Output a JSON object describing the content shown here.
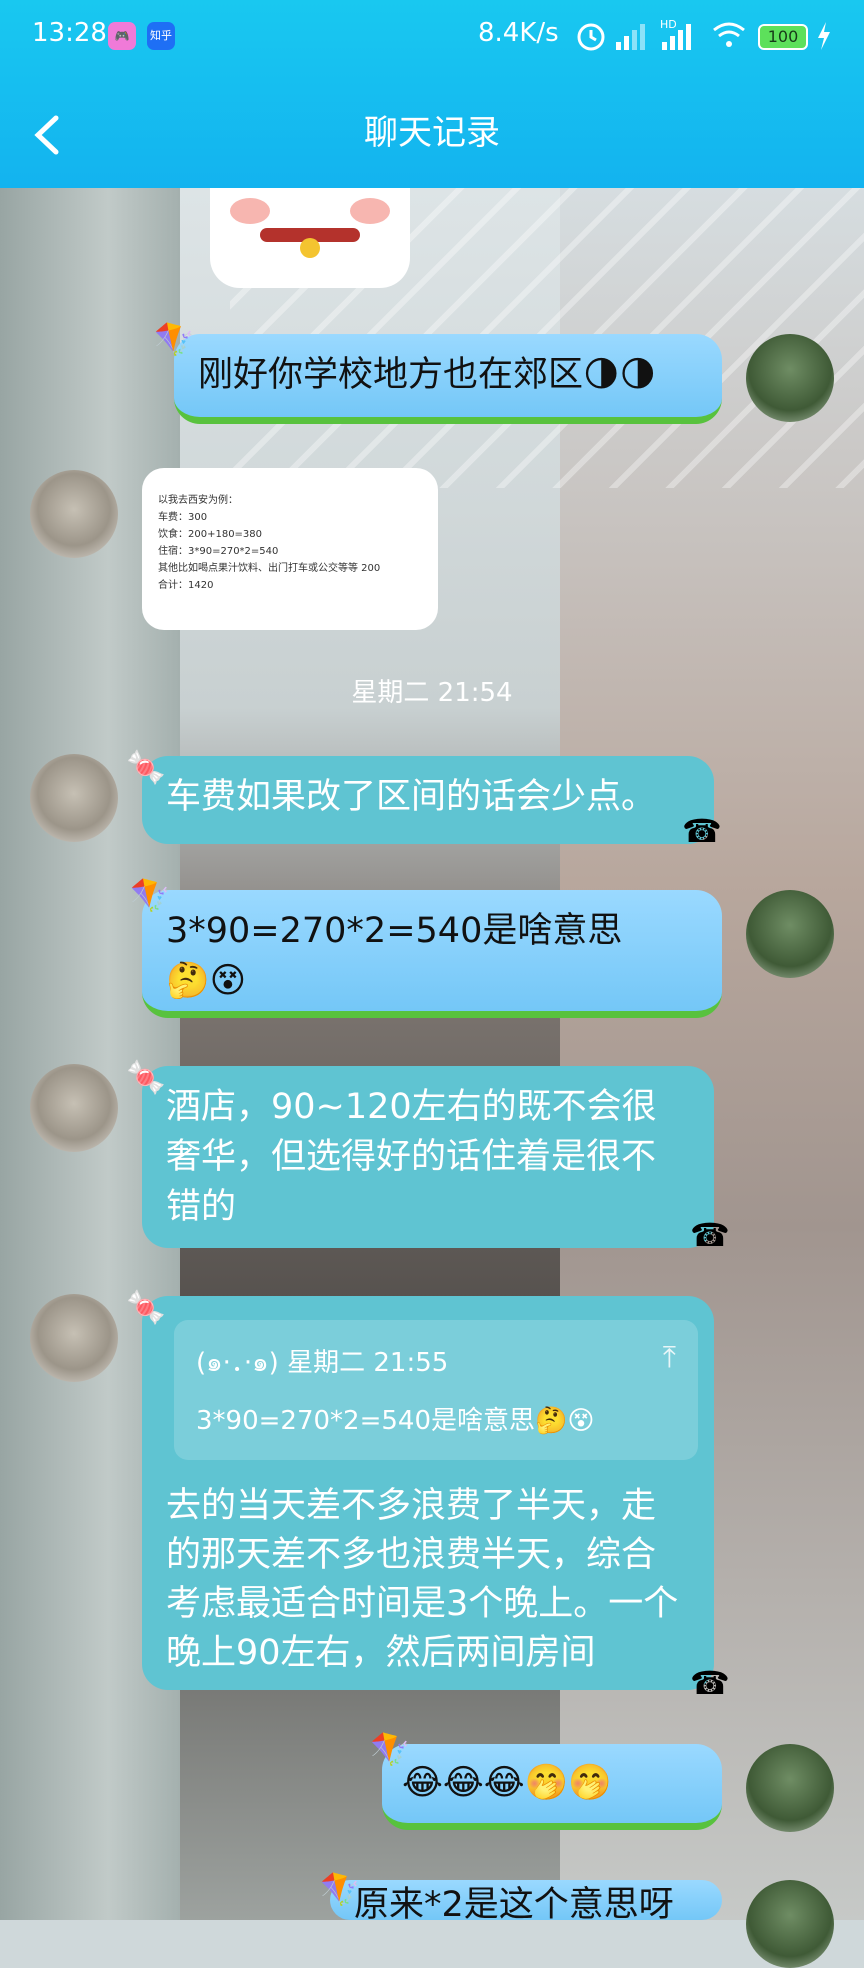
{
  "status_bar": {
    "time": "13:28",
    "badge_game": "",
    "badge_zhihu": "知乎",
    "net_speed": "8.4K/s",
    "signal_hd": "HD",
    "battery": "100"
  },
  "header": {
    "title": "聊天记录"
  },
  "timestamp": "星期二 21:54",
  "messages": [
    {
      "from": "self",
      "text": "刚好你学校地方也在郊区🌗🌗"
    },
    {
      "from": "other",
      "type": "document",
      "lines": [
        "以我去西安为例：",
        "车费：300",
        "饮食：200+180=380",
        "住宿：3*90=270*2=540",
        "其他比如喝点果汁饮料、出门打车或公交等等 200",
        "合计：1420"
      ]
    },
    {
      "from": "other",
      "text": "车费如果改了区间的话会少点。"
    },
    {
      "from": "self",
      "text": "3*90=270*2=540是啥意思🤔😵"
    },
    {
      "from": "other",
      "text": "酒店，90~120左右的既不会很奢华，但选得好的话住着是很不错的"
    },
    {
      "from": "other",
      "quote_head": "(๑·．·๑) 星期二 21:55",
      "quote_body": "3*90=270*2=540是啥意思🤔😵",
      "text": " 去的当天差不多浪费了半天，走的那天差不多也浪费半天，综合考虑最适合时间是3个晚上。一个晚上90左右，然后两间房间"
    },
    {
      "from": "self",
      "text": "😂😂😂🤭🤭"
    },
    {
      "from": "self",
      "text": "原来*2是这个意思呀"
    }
  ]
}
